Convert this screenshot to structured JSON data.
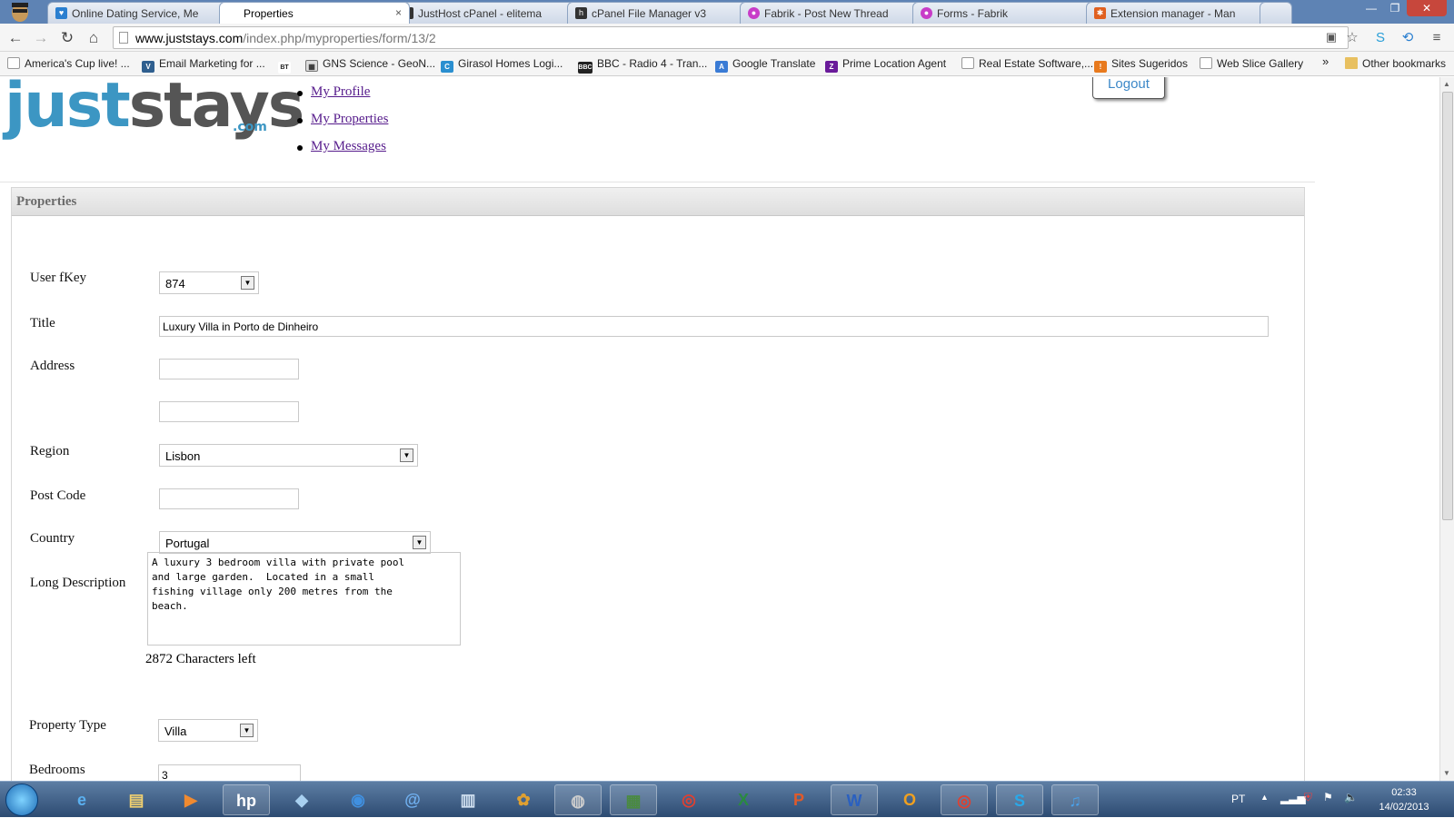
{
  "browser": {
    "tabs": [
      {
        "title": "Online Dating Service, Me",
        "active": false,
        "icon": "dating-favicon",
        "color": "#2a7fd0"
      },
      {
        "title": "Properties",
        "active": true,
        "icon": "none",
        "color": "#ffffff"
      },
      {
        "title": "JustHost cPanel - elitema",
        "active": false,
        "icon": "cpanel-favicon",
        "color": "#333333"
      },
      {
        "title": "cPanel File Manager v3",
        "active": false,
        "icon": "cpanel-favicon",
        "color": "#333333"
      },
      {
        "title": "Fabrik - Post New Thread",
        "active": false,
        "icon": "fabrik-favicon",
        "color": "#c83cc8"
      },
      {
        "title": "Forms - Fabrik",
        "active": false,
        "icon": "fabrik-favicon",
        "color": "#c83cc8"
      },
      {
        "title": "Extension manager - Man",
        "active": false,
        "icon": "joomla-favicon",
        "color": "#e06020"
      }
    ],
    "url_domain": "www.juststays.com",
    "url_path": "/index.php/myproperties/form/13/2",
    "bookmarks": [
      {
        "label": "America's Cup live! ...",
        "icon": "page-icon"
      },
      {
        "label": "Email Marketing for ...",
        "icon": "mailchimp-icon"
      },
      {
        "label": "GNS Science - GeoN...",
        "icon": "geonet-icon"
      },
      {
        "label": "Girasol Homes Logi...",
        "icon": "girasol-icon"
      },
      {
        "label": "BBC - Radio 4 - Tran...",
        "icon": "bbc-icon"
      },
      {
        "label": "Google Translate",
        "icon": "translate-icon"
      },
      {
        "label": "Prime Location Agent",
        "icon": "zoopla-icon"
      },
      {
        "label": "Real Estate Software,...",
        "icon": "page-icon"
      },
      {
        "label": "Sites Sugeridos",
        "icon": "suggested-icon"
      },
      {
        "label": "Web Slice Gallery",
        "icon": "page-icon"
      }
    ],
    "bookmarks_overflow": "»",
    "other_bookmarks": "Other bookmarks",
    "bt_badge": "BT",
    "bbc_badge": "BBC"
  },
  "site": {
    "logo_just": "just",
    "logo_stays": "stays",
    "logo_com": ".com",
    "nav": [
      "My Profile",
      "My Properties",
      "My Messages"
    ],
    "logout": "Logout"
  },
  "form": {
    "panel_title": "Properties",
    "user_fkey_label": "User fKey",
    "user_fkey_value": "874",
    "title_label": "Title",
    "title_value": "Luxury Villa in Porto de Dinheiro",
    "address_label": "Address",
    "address1_value": "",
    "address2_value": "",
    "region_label": "Region",
    "region_value": "Lisbon",
    "postcode_label": "Post Code",
    "postcode_value": "",
    "country_label": "Country",
    "country_value": "Portugal",
    "long_desc_label": "Long Description",
    "long_desc_value": "A luxury 3 bedroom villa with private pool\nand large garden.  Located in a small\nfishing village only 200 metres from the\nbeach.",
    "chars_left": "2872 Characters left",
    "property_type_label": "Property Type",
    "property_type_value": "Villa",
    "bedrooms_label": "Bedrooms",
    "bedrooms_value": "3"
  },
  "taskbar": {
    "language": "PT",
    "time": "02:33",
    "date": "14/02/2013",
    "apps": [
      "ie-icon",
      "explorer-icon",
      "media-player-icon",
      "hp-icon",
      "box-icon",
      "globe-icon",
      "spiral-icon",
      "panel-icon",
      "picasa-icon",
      "gimp-icon",
      "spreadsheet-icon",
      "chrome-icon",
      "excel-icon",
      "powerpoint-icon",
      "word-icon",
      "outlook-icon",
      "chrome-open-icon",
      "skype-icon",
      "itunes-icon"
    ]
  }
}
